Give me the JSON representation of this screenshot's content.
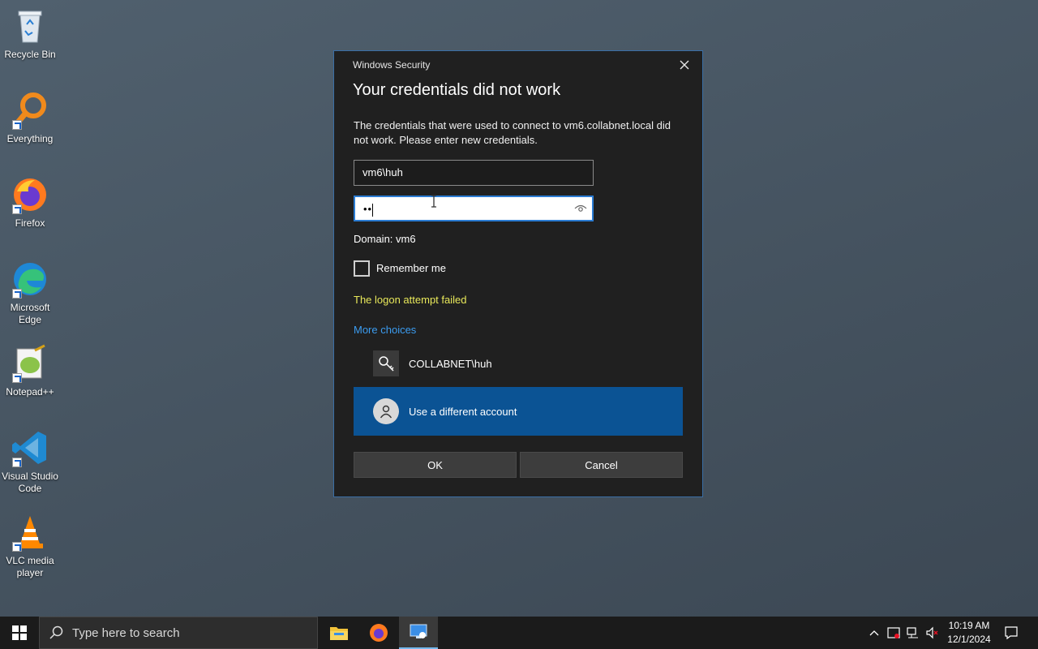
{
  "desktop": {
    "icons": [
      {
        "label": "Recycle Bin"
      },
      {
        "label": "Everything"
      },
      {
        "label": "Firefox"
      },
      {
        "label": "Microsoft Edge"
      },
      {
        "label": "Notepad++"
      },
      {
        "label": "Visual Studio Code"
      },
      {
        "label": "VLC media player"
      }
    ]
  },
  "dialog": {
    "app_name": "Windows Security",
    "title": "Your credentials did not work",
    "message": "The credentials that were used to connect to vm6.collabnet.local did not work. Please enter new credentials.",
    "username_value": "vm6\\huh",
    "password_mask": "••",
    "domain_text": "Domain: vm6",
    "remember_label": "Remember me",
    "remember_checked": false,
    "error_text": "The logon attempt failed",
    "more_choices_label": "More choices",
    "accounts": [
      {
        "label": "COLLABNET\\huh",
        "icon": "key-icon"
      },
      {
        "label": "Use a different account",
        "icon": "person-icon",
        "selected": true
      }
    ],
    "ok_label": "OK",
    "cancel_label": "Cancel",
    "colors": {
      "accent": "#0b5394",
      "error": "#e8e85a",
      "link": "#3b9cf0"
    }
  },
  "taskbar": {
    "search_placeholder": "Type here to search",
    "time": "10:19 AM",
    "date": "12/1/2024"
  }
}
